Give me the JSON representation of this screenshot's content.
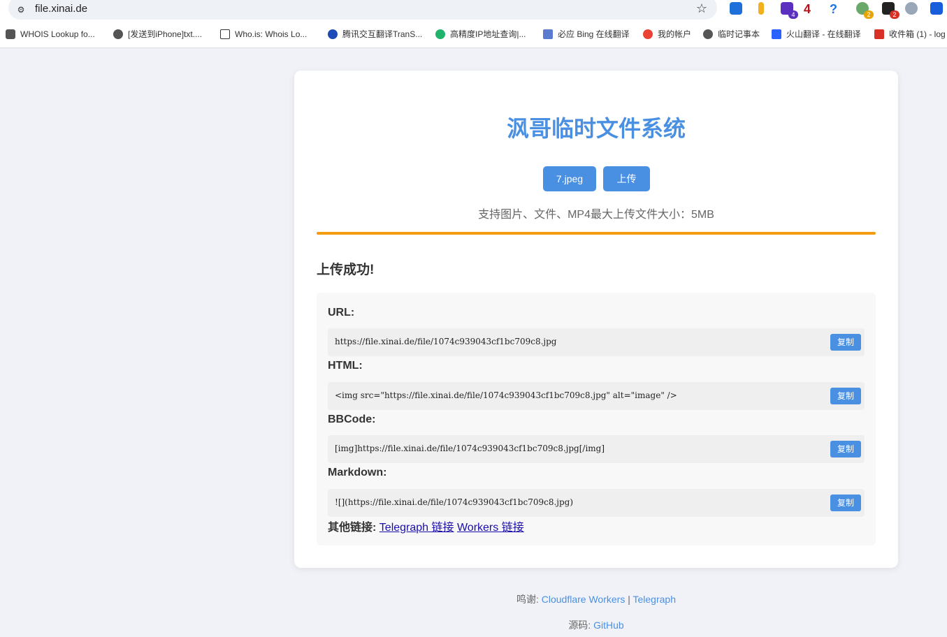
{
  "browser": {
    "url": "file.xinai.de",
    "extension_badges": [
      "4",
      "4",
      "2",
      "2"
    ],
    "bookmarks": [
      {
        "label": "WHOIS Lookup fo...",
        "icon": "gear-icon",
        "color": "#555555"
      },
      {
        "label": "[发送到iPhone]txt....",
        "icon": "globe-icon",
        "color": "#555555"
      },
      {
        "label": "Who.is: Whois Lo...",
        "icon": "w-icon",
        "color": "#333333"
      },
      {
        "label": "腾讯交互翻译TranS...",
        "icon": "tencent-icon",
        "color": "#1a4bb8"
      },
      {
        "label": "高精度IP地址查询|...",
        "icon": "ip-icon",
        "color": "#21b36b"
      },
      {
        "label": "必应 Bing 在线翻译",
        "icon": "bing-translate-icon",
        "color": "#5a7bd0"
      },
      {
        "label": "我的帐户",
        "icon": "google-icon",
        "color": "#ea4335"
      },
      {
        "label": "临时记事本",
        "icon": "globe-icon",
        "color": "#555555"
      },
      {
        "label": "火山翻译 - 在线翻译",
        "icon": "volcano-icon",
        "color": "#2a62ff"
      },
      {
        "label": "收件箱 (1) - log",
        "icon": "gmail-icon",
        "color": "#d93025"
      }
    ]
  },
  "page": {
    "title": "沨哥临时文件系统",
    "file_button": "7.jpeg",
    "upload_button": "上传",
    "hint": "支持图片、文件、MP4最大上传文件大小：5MB",
    "progress_percent": 100,
    "success_heading": "上传成功!",
    "results": [
      {
        "label": "URL:",
        "value": "https://file.xinai.de/file/1074c939043cf1bc709c8.jpg",
        "copy": "复制"
      },
      {
        "label": "HTML:",
        "value": "<img src=\"https://file.xinai.de/file/1074c939043cf1bc709c8.jpg\" alt=\"image\" />",
        "copy": "复制"
      },
      {
        "label": "BBCode:",
        "value": "[img]https://file.xinai.de/file/1074c939043cf1bc709c8.jpg[/img]",
        "copy": "复制"
      },
      {
        "label": "Markdown:",
        "value": "![](https://file.xinai.de/file/1074c939043cf1bc709c8.jpg)",
        "copy": "复制"
      }
    ],
    "other_links_label": "其他链接:",
    "telegraph_link": "Telegraph 链接",
    "workers_link": "Workers 链接"
  },
  "footer": {
    "thanks_label": "鸣谢: ",
    "cloudflare": "Cloudflare Workers",
    "separator": " | ",
    "telegraph": "Telegraph",
    "source_label": "源码: ",
    "github": "GitHub"
  },
  "colors": {
    "accent": "#4a90e2",
    "progress": "#f39c12",
    "background": "#f0f2f7"
  }
}
